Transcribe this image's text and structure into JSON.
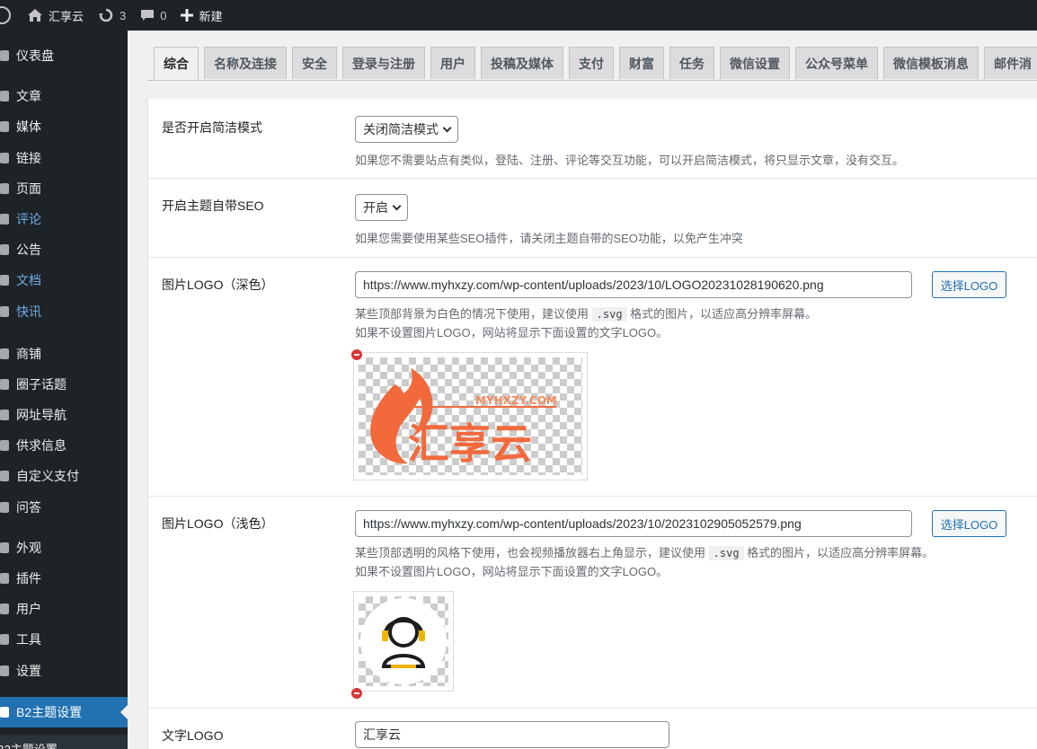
{
  "adminbar": {
    "site_name": "汇享云",
    "updates_count": "3",
    "comments_count": "0",
    "new_label": "新建"
  },
  "sidebar": {
    "items": [
      {
        "label": "仪表盘",
        "icon": "dashboard-icon"
      },
      {
        "label": "文章",
        "icon": "pin-icon"
      },
      {
        "label": "媒体",
        "icon": "media-icon"
      },
      {
        "label": "链接",
        "icon": "link-icon"
      },
      {
        "label": "页面",
        "icon": "page-icon"
      },
      {
        "label": "评论",
        "icon": "comment-icon"
      },
      {
        "label": "公告",
        "icon": "announcement-icon"
      },
      {
        "label": "文档",
        "icon": "document-icon"
      },
      {
        "label": "快讯",
        "icon": "flash-icon"
      },
      {
        "label": "商铺",
        "icon": "shop-icon"
      },
      {
        "label": "圈子话题",
        "icon": "circle-icon"
      },
      {
        "label": "网址导航",
        "icon": "navigation-icon"
      },
      {
        "label": "供求信息",
        "icon": "supply-icon"
      },
      {
        "label": "自定义支付",
        "icon": "payment-icon"
      },
      {
        "label": "问答",
        "icon": "question-icon"
      },
      {
        "label": "外观",
        "icon": "appearance-icon"
      },
      {
        "label": "插件",
        "icon": "plugin-icon"
      },
      {
        "label": "用户",
        "icon": "user-icon"
      },
      {
        "label": "工具",
        "icon": "tool-icon"
      },
      {
        "label": "设置",
        "icon": "settings-icon"
      },
      {
        "label": "B2主题设置",
        "icon": "theme-settings-icon"
      }
    ],
    "submenu_label": "B2主题设置"
  },
  "tabs": [
    "综合",
    "名称及连接",
    "安全",
    "登录与注册",
    "用户",
    "投稿及媒体",
    "支付",
    "财富",
    "任务",
    "微信设置",
    "公众号菜单",
    "微信模板消息",
    "邮件消"
  ],
  "settings": {
    "simple_mode": {
      "label": "是否开启简洁模式",
      "value": "关闭简洁模式",
      "desc": "如果您不需要站点有类似，登陆、注册、评论等交互功能，可以开启简洁模式，将只显示文章，没有交互。"
    },
    "seo": {
      "label": "开启主题自带SEO",
      "value": "开启",
      "desc": "如果您需要使用某些SEO插件，请关闭主题自带的SEO功能，以免产生冲突"
    },
    "logo_dark": {
      "label": "图片LOGO（深色）",
      "url": "https://www.myhxzy.com/wp-content/uploads/2023/10/LOGO20231028190620.png",
      "button": "选择LOGO",
      "desc1_pre": "某些顶部背景为白色的情况下使用，建议使用",
      "desc1_code": ".svg",
      "desc1_post": "格式的图片，以适应高分辨率屏幕。",
      "desc2": "如果不设置图片LOGO，网站将显示下面设置的文字LOGO。",
      "preview_text": "汇享云",
      "preview_sub": "MYHXZY.COM"
    },
    "logo_light": {
      "label": "图片LOGO（浅色）",
      "url": "https://www.myhxzy.com/wp-content/uploads/2023/10/2023102905052579.png",
      "button": "选择LOGO",
      "desc1_pre": "某些顶部透明的风格下使用，也会视频播放器右上角显示，建议使用",
      "desc1_code": ".svg",
      "desc1_post": "格式的图片，以适应高分辨率屏幕。",
      "desc2": "如果不设置图片LOGO，网站将显示下面设置的文字LOGO。"
    },
    "text_logo": {
      "label": "文字LOGO",
      "value": "汇享云"
    }
  }
}
